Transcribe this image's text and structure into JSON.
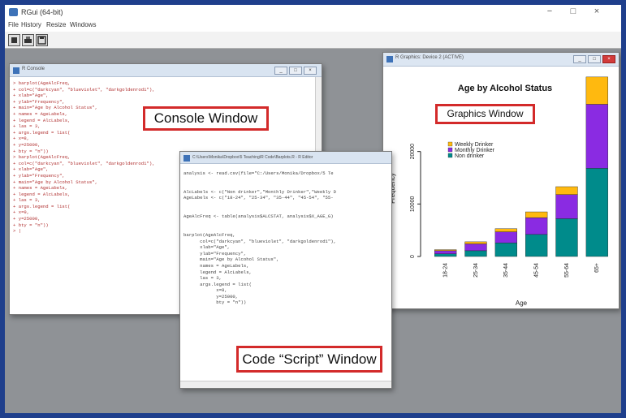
{
  "app": {
    "title": "RGui (64-bit)",
    "menu": [
      "File",
      "History",
      "Resize",
      "Windows"
    ],
    "window_controls": {
      "minimize": "−",
      "maximize": "□",
      "close": "×"
    }
  },
  "console": {
    "title": "R Console",
    "lines": [
      "> barplot(AgeAlcFreq,",
      "+ col=c(\"darkcyan\", \"blueviolet\", \"darkgoldenrod1\"),",
      "+ xlab=\"Age\",",
      "+ ylab=\"Frequency\",",
      "+ main=\"Age by Alcohol Status\",",
      "+ names = AgeLabels,",
      "+ legend = AlcLabels,",
      "+ las = 3,",
      "+ args.legend = list(",
      "+ x=8,",
      "+ y=25000,",
      "+ bty = \"n\"))",
      "> barplot(AgeAlcFreq,",
      "+ col=c(\"darkcyan\", \"blueviolet\", \"darkgoldenrod1\"),",
      "+ xlab=\"Age\",",
      "+ ylab=\"Frequency\",",
      "+ main=\"Age by Alcohol Status\",",
      "+ names = AgeLabels,",
      "+ legend = AlcLabels,",
      "+ las = 3,",
      "+ args.legend = list(",
      "+ x=9,",
      "+ y=25000,",
      "+ bty = \"n\"))",
      "> |"
    ],
    "callout": "Console Window"
  },
  "script": {
    "title": "C:\\Users\\Monika\\Dropbox\\5 Teaching\\R Code\\Barplots.R - R Editor",
    "lines": [
      "analysis <- read.csv(file=\"C:/Users/Monika/Dropbox/5 Te",
      "",
      "",
      "AlcLabels <- c(\"Non drinker\",\"Monthly Drinker\",\"Weekly D",
      "AgeLabels <- c(\"18-24\", \"25-34\", \"35-44\", \"45-54\", \"55-",
      "",
      "",
      "AgeAlcFreq <- table(analysis$ALCSTAT, analysis$X_AGE_G)",
      "",
      "",
      "barplot(AgeAlcFreq,",
      "      col=c(\"darkcyan\", \"blueviolet\", \"darkgoldenrod1\"),",
      "      xlab=\"Age\",",
      "      ylab=\"Frequency\",",
      "      main=\"Age by Alcohol Status\",",
      "      names = AgeLabels,",
      "      legend = AlcLabels,",
      "      las = 3,",
      "      args.legend = list(",
      "            x=8,",
      "            y=25000,",
      "            bty = \"n\"))"
    ],
    "callout": "Code “Script” Window"
  },
  "graphics": {
    "title": "R Graphics: Device 2 (ACTIVE)",
    "callout": "Graphics Window"
  },
  "chart_data": {
    "type": "bar",
    "stacked": true,
    "title": "Age by Alcohol Status",
    "xlabel": "Age",
    "ylabel": "Frequency",
    "categories": [
      "18-24",
      "25-34",
      "35-44",
      "45-54",
      "55-64",
      "65+"
    ],
    "yticks": [
      0,
      10000,
      20000
    ],
    "ylim": [
      0,
      30000
    ],
    "series": [
      {
        "name": "Non drinker",
        "color": "#008b8b",
        "values": [
          500,
          1100,
          2600,
          4200,
          7200,
          16800
        ]
      },
      {
        "name": "Monthly Drinker",
        "color": "#8a2be2",
        "values": [
          600,
          1300,
          2100,
          3200,
          4600,
          12200
        ]
      },
      {
        "name": "Weekly Drinker",
        "color": "#ffb90f",
        "values": [
          200,
          400,
          600,
          1100,
          1500,
          5200
        ]
      }
    ],
    "legend_labels": [
      "Weekly Drinker",
      "Monthly Drinker",
      "Non drinker"
    ],
    "legend_position": "top-left"
  }
}
